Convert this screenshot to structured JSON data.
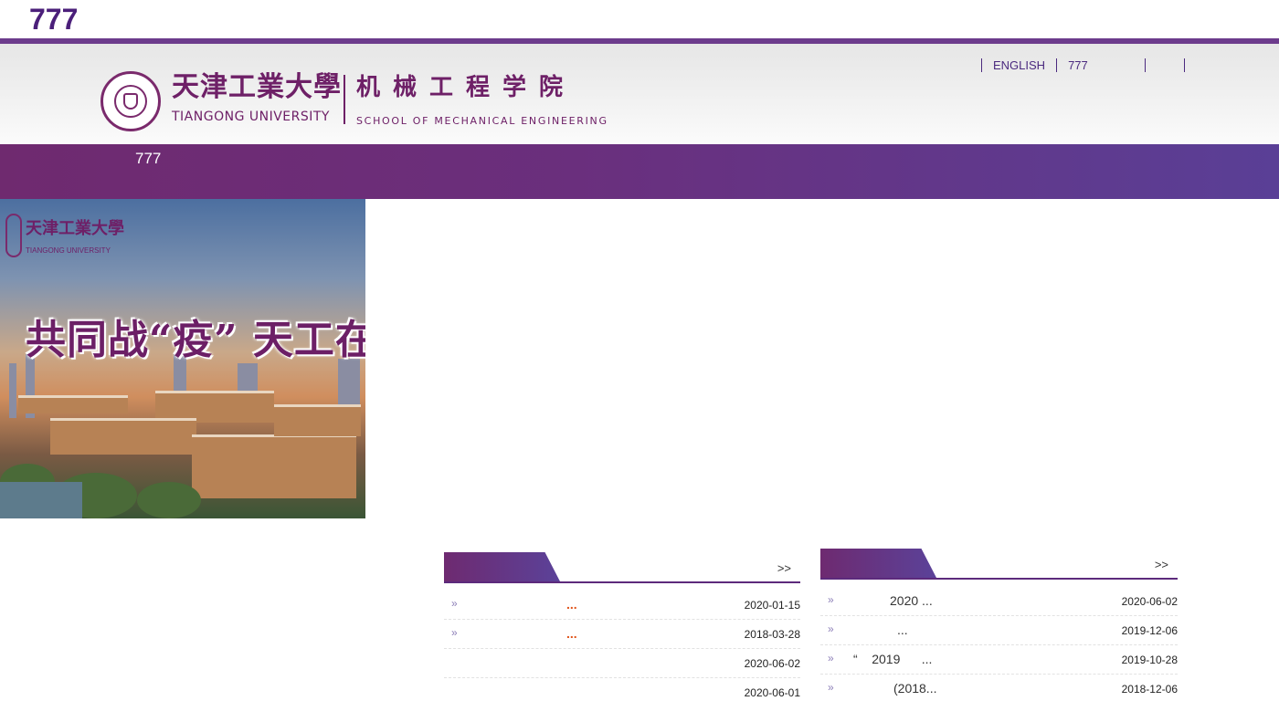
{
  "page": {
    "top_title": "777"
  },
  "header": {
    "university_cn": "天津工業大學",
    "university_en": "TIANGONG UNIVERSITY",
    "school_cn": "机械工程学院",
    "school_en": "SCHOOL OF MECHANICAL ENGINEERING",
    "links": [
      "ENGLISH",
      "777",
      "",
      ""
    ]
  },
  "nav": {
    "items": [
      "777"
    ]
  },
  "banner": {
    "logo_cn": "天津工業大學",
    "logo_en": "TIANGONG UNIVERSITY",
    "slogan": "共同战“疫” 天工在行动"
  },
  "panel_left": {
    "more": ">>",
    "rows": [
      {
        "arrow": "»",
        "title": "...",
        "hot": true,
        "date": "2020-01-15"
      },
      {
        "arrow": "»",
        "title": "...",
        "hot": true,
        "date": "2018-03-28"
      },
      {
        "arrow": "",
        "title": "",
        "hot": false,
        "date": "2020-06-02"
      },
      {
        "arrow": "",
        "title": "",
        "hot": false,
        "date": "2020-06-01"
      }
    ]
  },
  "panel_right": {
    "more": ">>",
    "rows": [
      {
        "arrow": "»",
        "title": "2020 ...",
        "date": "2020-06-02"
      },
      {
        "arrow": "»",
        "title": "...",
        "date": "2019-12-06"
      },
      {
        "arrow": "»",
        "title": "“    2019      ...",
        "date": "2019-10-28"
      },
      {
        "arrow": "»",
        "title": "(2018...",
        "date": "2018-12-06"
      }
    ]
  },
  "colors": {
    "brand_purple": "#6e2067",
    "nav_start": "#6f2a6f",
    "nav_end": "#5a3f96",
    "hot_text": "#e0541a"
  }
}
